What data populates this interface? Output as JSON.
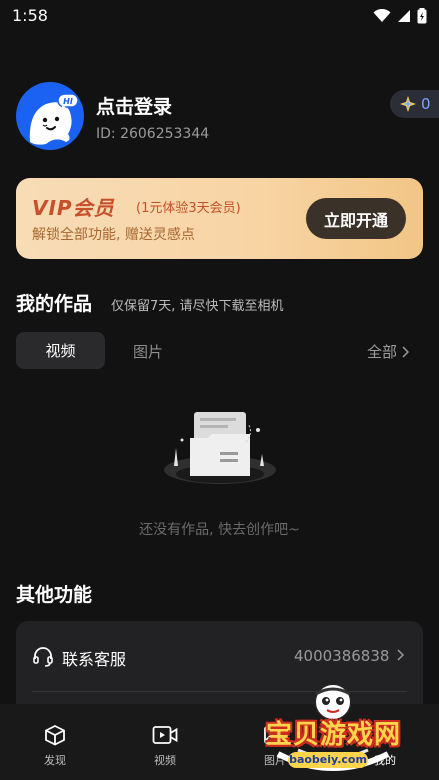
{
  "status_bar": {
    "time": "1:58"
  },
  "profile": {
    "login_label": "点击登录",
    "user_id": "ID: 2606253344",
    "avatar_text": "HI",
    "points": "0",
    "colors": {
      "avatar_bg": "#1b61f2"
    }
  },
  "vip": {
    "title": "VIP会员",
    "trial": "(1元体验3天会员)",
    "description": "解锁全部功能, 赠送灵感点",
    "button_label": "立即开通",
    "colors": {
      "accent": "#c5502a",
      "button_bg": "#3a3129"
    }
  },
  "works": {
    "title": "我的作品",
    "note": "仅保留7天, 请尽快下载至相机",
    "tabs": [
      {
        "label": "视频",
        "selected": true
      },
      {
        "label": "图片",
        "selected": false
      }
    ],
    "all_label": "全部",
    "empty_text": "还没有作品, 快去创作吧~"
  },
  "other": {
    "title": "其他功能",
    "items": [
      {
        "label": "联系客服",
        "value": "4000386838",
        "icon": "headset-icon"
      }
    ]
  },
  "tab_bar": {
    "items": [
      {
        "label": "发现",
        "icon": "cube-icon"
      },
      {
        "label": "视频",
        "icon": "video-icon"
      },
      {
        "label": "图片",
        "icon": "image-icon"
      },
      {
        "label": "我的",
        "icon": "profile-icon",
        "active": true
      }
    ]
  },
  "watermark": {
    "title": "宝贝游戏网",
    "url": "baobeiy.com"
  }
}
